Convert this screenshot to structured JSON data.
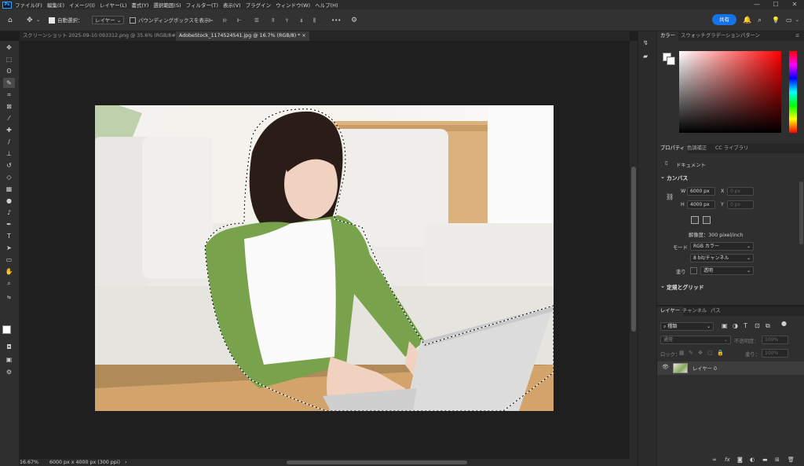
{
  "menubar": {
    "logo": "Ps",
    "items": [
      "ファイル(F)",
      "編集(E)",
      "イメージ(I)",
      "レイヤー(L)",
      "書式(Y)",
      "選択範囲(S)",
      "フィルター(T)",
      "表示(V)",
      "プラグイン",
      "ウィンドウ(W)",
      "ヘルプ(H)"
    ]
  },
  "options": {
    "auto_select_label": "自動選択：",
    "auto_select_value": "レイヤー",
    "bbox_label": "バウンディングボックスを表示",
    "more": "•••",
    "share": "共有"
  },
  "tabs": [
    {
      "label": "スクリーンショット 2025-09-10 093312.png @ 35.6% (RGB/8#)",
      "close": "×"
    },
    {
      "label": "AdobeStock_1174524541.jpg @ 16.7% (RGB/8) *",
      "close": "×"
    }
  ],
  "status": {
    "zoom": "16.67%",
    "doc": "6000 px x 4000 px (300 ppi)"
  },
  "color_panel": {
    "tabs": [
      "カラー",
      "スウォッチ",
      "グラデーション",
      "パターン"
    ]
  },
  "properties": {
    "tabs": [
      "プロパティ",
      "色調補正",
      "CC ライブラリ"
    ],
    "document_label": "ドキュメント",
    "canvas_title": "カンバス",
    "w_label": "W",
    "w_value": "6000 px",
    "x_label": "X",
    "x_value": "0 px",
    "h_label": "H",
    "h_value": "4000 px",
    "y_label": "Y",
    "y_value": "0 px",
    "resolution": "解像度：300 pixel/inch",
    "mode_label": "モード",
    "mode_value": "RGB カラー",
    "bits_value": "8 bit/チャンネル",
    "fill_label": "塗り",
    "fill_value": "透明",
    "rulers_title": "定規とグリッド"
  },
  "layers": {
    "tabs": [
      "レイヤー",
      "チャンネル",
      "パス"
    ],
    "filter": "種類",
    "blend": "通常",
    "opacity_label": "不透明度：",
    "opacity_value": "100%",
    "lock_label": "ロック：",
    "fill_label": "塗り：",
    "fill_value": "100%",
    "layer_name": "レイヤー 0"
  },
  "window_controls": [
    "—",
    "☐",
    "✕"
  ]
}
